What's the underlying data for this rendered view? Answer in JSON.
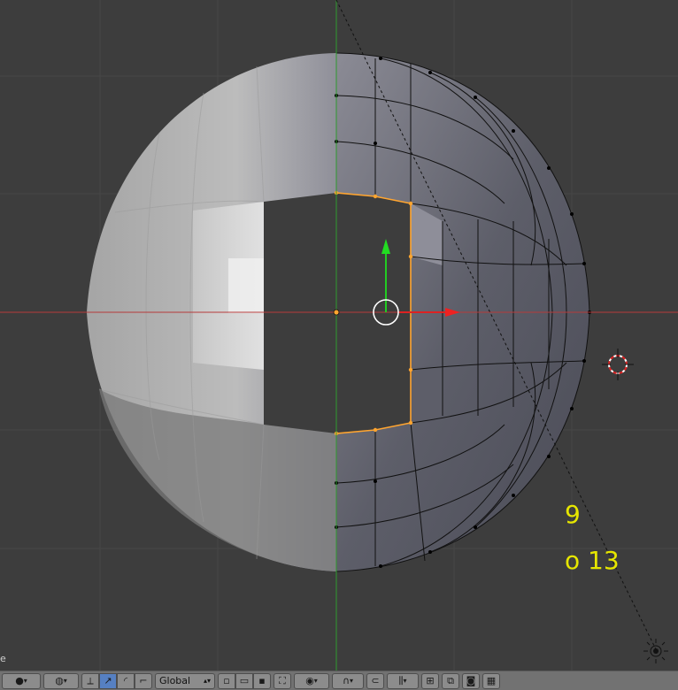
{
  "viewport": {
    "annotations": {
      "line1": "9",
      "line2": "o 13"
    },
    "mode_label_fragment": "e"
  },
  "header": {
    "orientation_label": "Global",
    "icons": [
      "sphere-shading-icon",
      "editor-layers-icon",
      "transform-manipulator-icon",
      "translate-icon",
      "rotate-icon",
      "scale-icon",
      "vertex-select-icon",
      "edge-select-icon",
      "face-select-icon",
      "limit-selection-icon",
      "proportional-edit-icon",
      "falloff-icon",
      "snap-icon",
      "snap-element-icon",
      "snap-target-icon",
      "mirror-icon",
      "render-icon",
      "animation-render-icon"
    ]
  },
  "colors": {
    "background": "#3d3d3d",
    "x_axis": "#b63a3a",
    "y_axis": "#2f9a2f",
    "selection": "#ffa530",
    "annotation": "#e6e600"
  }
}
